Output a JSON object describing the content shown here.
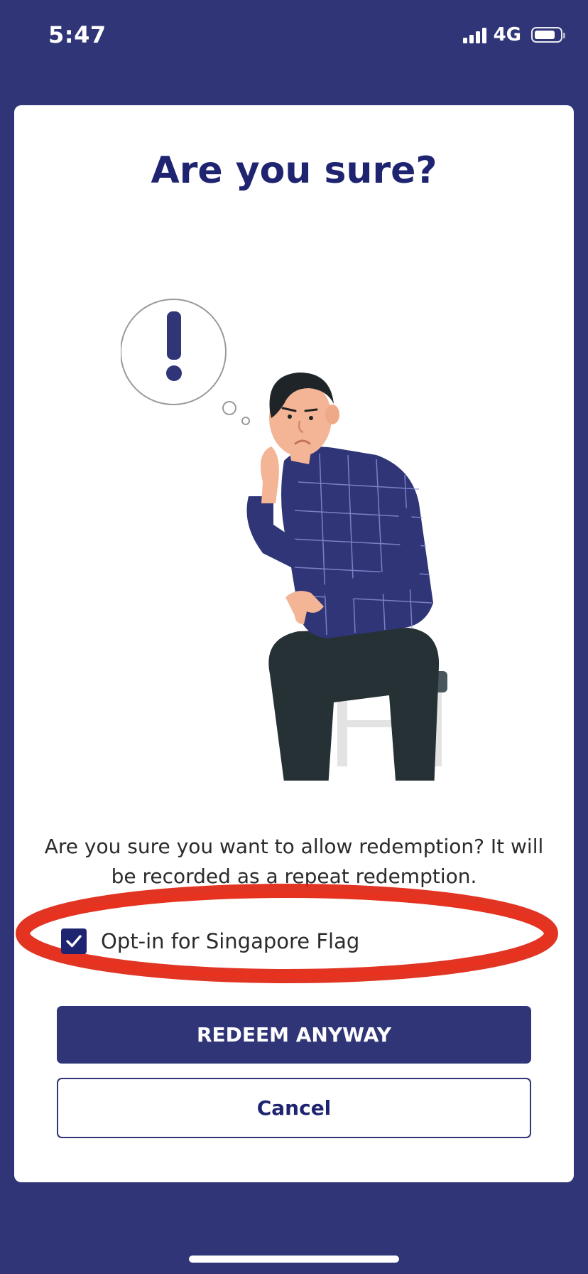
{
  "status_bar": {
    "time": "5:47",
    "network": "4G",
    "icons": [
      "signal-icon",
      "battery-icon"
    ]
  },
  "dialog": {
    "title": "Are you sure?",
    "illustration": "confused-man-sitting-illustration",
    "message": "Are you sure you want to allow redemption? It will be recorded as a repeat redemption.",
    "checkbox": {
      "label": "Opt-in for Singapore Flag",
      "checked": true
    },
    "primary_button_label": "REDEEM ANYWAY",
    "secondary_button_label": "Cancel"
  },
  "colors": {
    "background": "#2f3577",
    "title": "#1f2470",
    "annotation": "#e02310",
    "card": "#ffffff"
  }
}
